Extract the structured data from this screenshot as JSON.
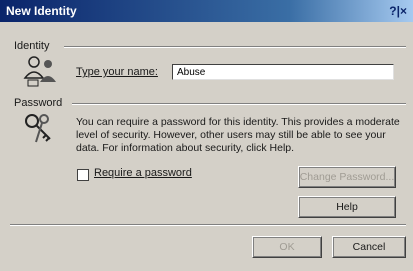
{
  "window": {
    "title": "New Identity",
    "controls": "?|×"
  },
  "identity_group": {
    "heading": "Identity",
    "name_label": "Type your name:",
    "name_value": "Abuse"
  },
  "password_group": {
    "heading": "Password",
    "info": "You can require a password for this identity.  This provides a moderate level of security. However, other users may still be able to see your data. For information about security, click Help.",
    "require_label": "Require a password",
    "require_checked": false,
    "change_password_label": "Change Password...",
    "help_label": "Help"
  },
  "footer": {
    "ok_label": "OK",
    "cancel_label": "Cancel"
  }
}
